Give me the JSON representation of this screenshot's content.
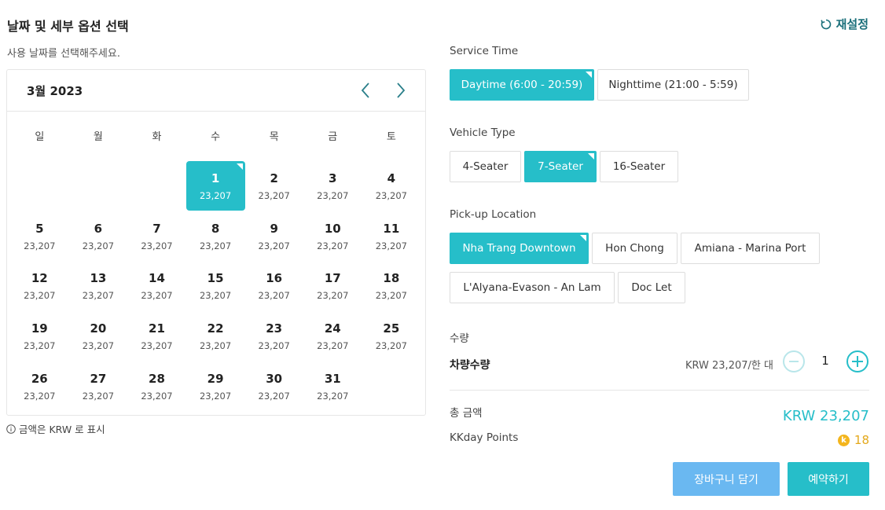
{
  "header": {
    "title": "날짜 및 세부 옵션 선택",
    "reset_label": "재설정",
    "subtitle": "사용 날짜를 선택해주세요."
  },
  "calendar": {
    "month_label": "3월 2023",
    "weekdays": [
      "일",
      "월",
      "화",
      "수",
      "목",
      "금",
      "토"
    ],
    "leading_blanks": 3,
    "selected_day": "1",
    "days": [
      {
        "num": "1",
        "price": "23,207"
      },
      {
        "num": "2",
        "price": "23,207"
      },
      {
        "num": "3",
        "price": "23,207"
      },
      {
        "num": "4",
        "price": "23,207"
      },
      {
        "num": "5",
        "price": "23,207"
      },
      {
        "num": "6",
        "price": "23,207"
      },
      {
        "num": "7",
        "price": "23,207"
      },
      {
        "num": "8",
        "price": "23,207"
      },
      {
        "num": "9",
        "price": "23,207"
      },
      {
        "num": "10",
        "price": "23,207"
      },
      {
        "num": "11",
        "price": "23,207"
      },
      {
        "num": "12",
        "price": "23,207"
      },
      {
        "num": "13",
        "price": "23,207"
      },
      {
        "num": "14",
        "price": "23,207"
      },
      {
        "num": "15",
        "price": "23,207"
      },
      {
        "num": "16",
        "price": "23,207"
      },
      {
        "num": "17",
        "price": "23,207"
      },
      {
        "num": "18",
        "price": "23,207"
      },
      {
        "num": "19",
        "price": "23,207"
      },
      {
        "num": "20",
        "price": "23,207"
      },
      {
        "num": "21",
        "price": "23,207"
      },
      {
        "num": "22",
        "price": "23,207"
      },
      {
        "num": "23",
        "price": "23,207"
      },
      {
        "num": "24",
        "price": "23,207"
      },
      {
        "num": "25",
        "price": "23,207"
      },
      {
        "num": "26",
        "price": "23,207"
      },
      {
        "num": "27",
        "price": "23,207"
      },
      {
        "num": "28",
        "price": "23,207"
      },
      {
        "num": "29",
        "price": "23,207"
      },
      {
        "num": "30",
        "price": "23,207"
      },
      {
        "num": "31",
        "price": "23,207"
      }
    ],
    "note": "금액은 KRW 로 표시"
  },
  "options": {
    "service_time": {
      "label": "Service Time",
      "items": [
        "Daytime (6:00 - 20:59)",
        "Nighttime (21:00 - 5:59)"
      ],
      "selected": 0
    },
    "vehicle_type": {
      "label": "Vehicle Type",
      "items": [
        "4-Seater",
        "7-Seater",
        "16-Seater"
      ],
      "selected": 1
    },
    "pickup_location": {
      "label": "Pick-up Location",
      "items": [
        "Nha Trang Downtown",
        "Hon Chong",
        "Amiana - Marina Port",
        "L'Alyana-Evason - An Lam",
        "Doc Let"
      ],
      "selected": 0
    }
  },
  "quantity": {
    "section_label": "수량",
    "item_label": "차량수량",
    "unit_price": "KRW 23,207/한 대",
    "value": "1"
  },
  "summary": {
    "total_label": "총 금액",
    "total_value": "KRW 23,207",
    "points_label": "KKday Points",
    "points_value": "18",
    "coin_letter": "k"
  },
  "actions": {
    "cart_label": "장바구니 담기",
    "book_label": "예약하기"
  },
  "colors": {
    "accent": "#26bec9",
    "cart_button": "#6ab8f1",
    "points": "#e3a81b"
  }
}
